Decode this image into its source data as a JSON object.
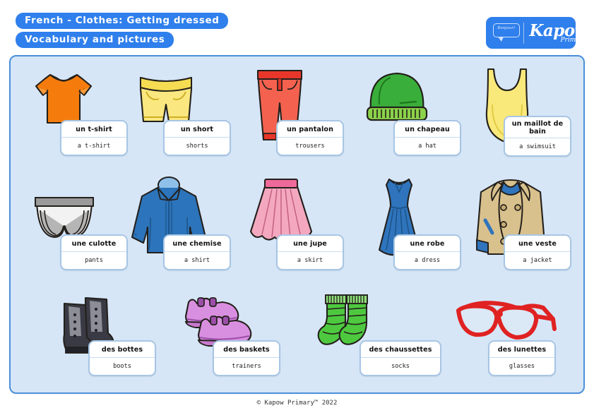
{
  "header": {
    "title": "French - Clothes: Getting dressed",
    "subtitle": "Vocabulary and pictures",
    "pill_color": "#2f7fec"
  },
  "logo": {
    "bubble_text": "Bonjour!",
    "brand": "Kapow",
    "brand_sub": "Primary",
    "background": "#2f7fec"
  },
  "panel": {
    "background": "#d6e6f7",
    "border_color": "#4a90d9"
  },
  "footer": {
    "copyright": "© Kapow Primary™ 2022"
  },
  "vocabulary": {
    "rows": [
      [
        {
          "french": "un t-shirt",
          "english": "a t-shirt",
          "icon": "t-shirt-icon",
          "color": "#f57c0c"
        },
        {
          "french": "un short",
          "english": "shorts",
          "icon": "shorts-icon",
          "color": "#fae77f"
        },
        {
          "french": "un pantalon",
          "english": "trousers",
          "icon": "trousers-icon",
          "color": "#f4624f"
        },
        {
          "french": "un chapeau",
          "english": "a hat",
          "icon": "hat-icon",
          "color": "#3aae3a"
        },
        {
          "french": "un maillot de bain",
          "english": "a swimsuit",
          "icon": "swimsuit-icon",
          "color": "#f9e87a"
        }
      ],
      [
        {
          "french": "une culotte",
          "english": "pants",
          "icon": "underwear-icon",
          "color": "#f2f2f2"
        },
        {
          "french": "une chemise",
          "english": "a shirt",
          "icon": "shirt-icon",
          "color": "#2c74bb"
        },
        {
          "french": "une jupe",
          "english": "a skirt",
          "icon": "skirt-icon",
          "color": "#f4a8c0"
        },
        {
          "french": "une robe",
          "english": "a dress",
          "icon": "dress-icon",
          "color": "#2f74bc"
        },
        {
          "french": "une veste",
          "english": "a jacket",
          "icon": "jacket-icon",
          "color": "#d9c18d"
        }
      ],
      [
        {
          "french": "des bottes",
          "english": "boots",
          "icon": "boots-icon",
          "color": "#3a3a44"
        },
        {
          "french": "des baskets",
          "english": "trainers",
          "icon": "trainers-icon",
          "color": "#d98fe0"
        },
        {
          "french": "des chaussettes",
          "english": "socks",
          "icon": "socks-icon",
          "color": "#4ec93f"
        },
        {
          "french": "des lunettes",
          "english": "glasses",
          "icon": "glasses-icon",
          "color": "#e02222"
        }
      ]
    ]
  }
}
